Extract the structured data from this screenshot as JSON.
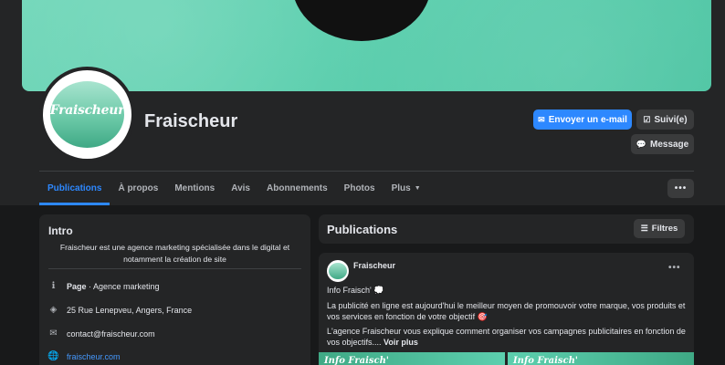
{
  "colors": {
    "accent": "#2d88ff",
    "background": "#18191a",
    "card": "#242526",
    "brand": "#5ccfae"
  },
  "page": {
    "name": "Fraischeur",
    "avatar_text": "Fraischeur"
  },
  "actions": {
    "email_label": "Envoyer un e-mail",
    "email_icon": "envelope-icon",
    "follow_label": "Suivi(e)",
    "follow_icon": "follow-check-icon",
    "message_label": "Message",
    "message_icon": "messenger-icon",
    "more_label": "•••"
  },
  "tabs": [
    {
      "label": "Publications",
      "active": true
    },
    {
      "label": "À propos"
    },
    {
      "label": "Mentions"
    },
    {
      "label": "Avis"
    },
    {
      "label": "Abonnements"
    },
    {
      "label": "Photos"
    },
    {
      "label": "Plus"
    }
  ],
  "intro": {
    "title": "Intro",
    "description": "Fraischeur est une agence marketing spécialisée dans le digital et notamment la création de site",
    "category_label": "Page",
    "category_value": " · Agence marketing",
    "address": "25 Rue Lenepveu, Angers, France",
    "email": "contact@fraischeur.com",
    "website": "fraischeur.com"
  },
  "publications": {
    "title": "Publications",
    "filter_label": "Filtres"
  },
  "post": {
    "author": "Fraischeur",
    "dots": "•••",
    "line1": "Info Fraisch' 💭",
    "line2": "La publicité en ligne est aujourd'hui le meilleur moyen de promouvoir votre marque, vos produits et vos services en fonction de votre objectif 🎯",
    "line3a": "L'agence Fraischeur vous explique comment organiser vos campagnes publicitaires en fonction de vos objectifs....",
    "see_more": "Voir plus",
    "image_caption_1": "Info Fraisch'",
    "image_caption_2": "Info Fraisch'"
  }
}
